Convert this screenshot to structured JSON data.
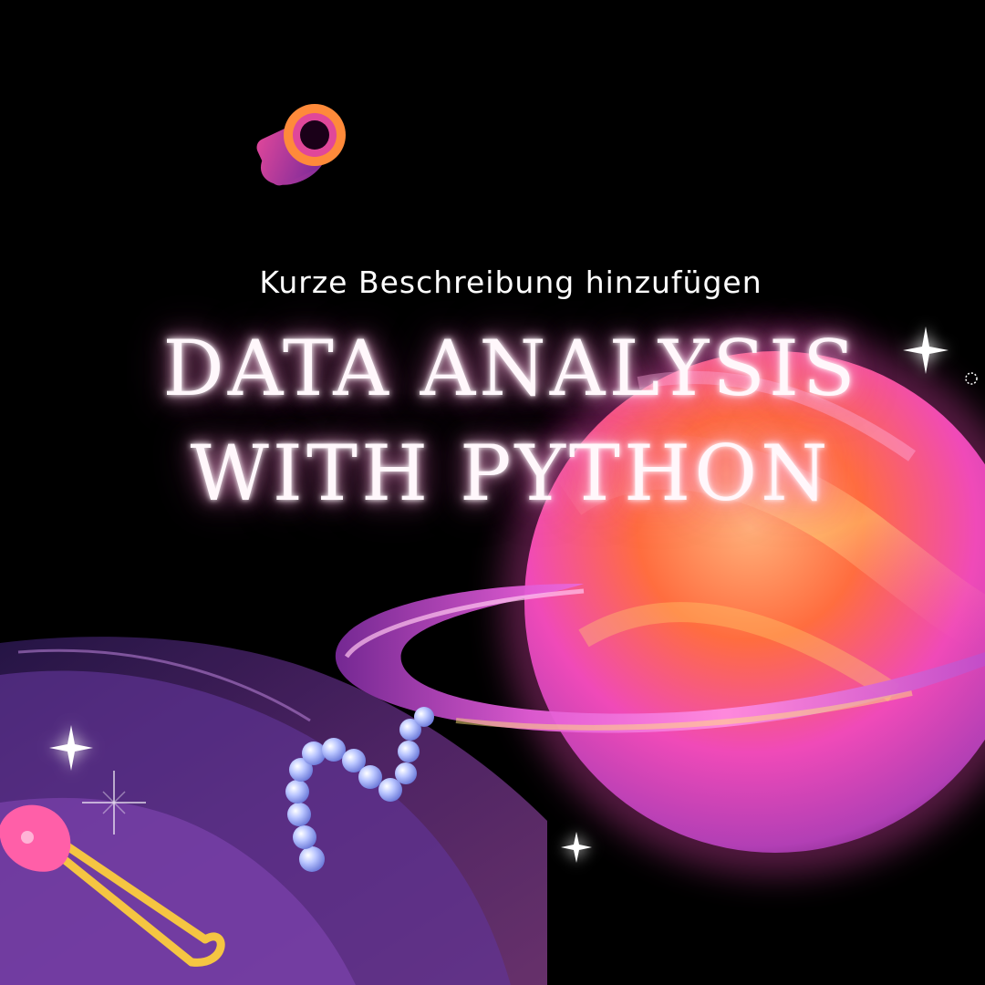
{
  "subtitle": "Kurze Beschreibung hinzufügen",
  "title_line1": "DATA ANALYSIS",
  "title_line2": "WITH PYTHON",
  "colors": {
    "background": "#000000",
    "planet_orange": "#ff7a3a",
    "planet_pink": "#f04ab8",
    "ring_magenta": "#d94fd0",
    "ribbon_purple": "#7a3fb0",
    "pin_pink": "#ff5fa8",
    "pin_gold": "#f5c542",
    "beads_blue": "#a9b8ff"
  },
  "icons": [
    "ring-tube-icon",
    "sparkle-icon",
    "safety-pin-icon",
    "pearl-chain-icon",
    "planet-icon"
  ]
}
